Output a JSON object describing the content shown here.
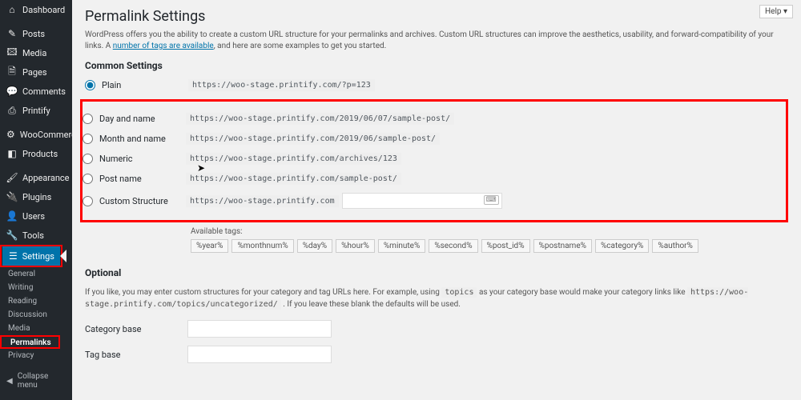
{
  "help_button": "Help ▾",
  "sidebar": {
    "items": [
      {
        "name": "dashboard",
        "label": "Dashboard",
        "icon": "⌂"
      },
      {
        "name": "posts",
        "label": "Posts",
        "icon": "✎"
      },
      {
        "name": "media",
        "label": "Media",
        "icon": "🖾"
      },
      {
        "name": "pages",
        "label": "Pages",
        "icon": "🗎"
      },
      {
        "name": "comments",
        "label": "Comments",
        "icon": "💬"
      },
      {
        "name": "printify",
        "label": "Printify",
        "icon": "⎙"
      },
      {
        "name": "woocommerce",
        "label": "WooCommerce",
        "icon": "⚙"
      },
      {
        "name": "products",
        "label": "Products",
        "icon": "◧"
      },
      {
        "name": "appearance",
        "label": "Appearance",
        "icon": "🖌"
      },
      {
        "name": "plugins",
        "label": "Plugins",
        "icon": "🔌"
      },
      {
        "name": "users",
        "label": "Users",
        "icon": "👤"
      },
      {
        "name": "tools",
        "label": "Tools",
        "icon": "🔧"
      },
      {
        "name": "settings",
        "label": "Settings",
        "icon": "☰"
      }
    ],
    "sub_items": [
      {
        "name": "general",
        "label": "General"
      },
      {
        "name": "writing",
        "label": "Writing"
      },
      {
        "name": "reading",
        "label": "Reading"
      },
      {
        "name": "discussion",
        "label": "Discussion"
      },
      {
        "name": "media",
        "label": "Media"
      },
      {
        "name": "permalinks",
        "label": "Permalinks"
      },
      {
        "name": "privacy",
        "label": "Privacy"
      }
    ],
    "collapse": "Collapse menu"
  },
  "page": {
    "title": "Permalink Settings",
    "description_pre": "WordPress offers you the ability to create a custom URL structure for your permalinks and archives. Custom URL structures can improve the aesthetics, usability, and forward-compatibility of your links. A ",
    "description_link": "number of tags are available",
    "description_post": ", and here are some examples to get you started.",
    "common_heading": "Common Settings",
    "structures": [
      {
        "name": "plain",
        "label": "Plain",
        "url": "https://woo-stage.printify.com/?p=123",
        "checked": true
      },
      {
        "name": "day-name",
        "label": "Day and name",
        "url": "https://woo-stage.printify.com/2019/06/07/sample-post/"
      },
      {
        "name": "month-name",
        "label": "Month and name",
        "url": "https://woo-stage.printify.com/2019/06/sample-post/"
      },
      {
        "name": "numeric",
        "label": "Numeric",
        "url": "https://woo-stage.printify.com/archives/123"
      },
      {
        "name": "post-name",
        "label": "Post name",
        "url": "https://woo-stage.printify.com/sample-post/"
      },
      {
        "name": "custom",
        "label": "Custom Structure",
        "url": "https://woo-stage.printify.com"
      }
    ],
    "available_tags_label": "Available tags:",
    "tags": [
      "%year%",
      "%monthnum%",
      "%day%",
      "%hour%",
      "%minute%",
      "%second%",
      "%post_id%",
      "%postname%",
      "%category%",
      "%author%"
    ],
    "optional_heading": "Optional",
    "optional_desc_pre": "If you like, you may enter custom structures for your category and tag URLs here. For example, using ",
    "optional_code1": "topics",
    "optional_desc_mid": " as your category base would make your category links like ",
    "optional_code2": "https://woo-stage.printify.com/topics/uncategorized/",
    "optional_desc_post": " . If you leave these blank the defaults will be used.",
    "category_base_label": "Category base",
    "tag_base_label": "Tag base",
    "category_base_value": "",
    "tag_base_value": ""
  }
}
